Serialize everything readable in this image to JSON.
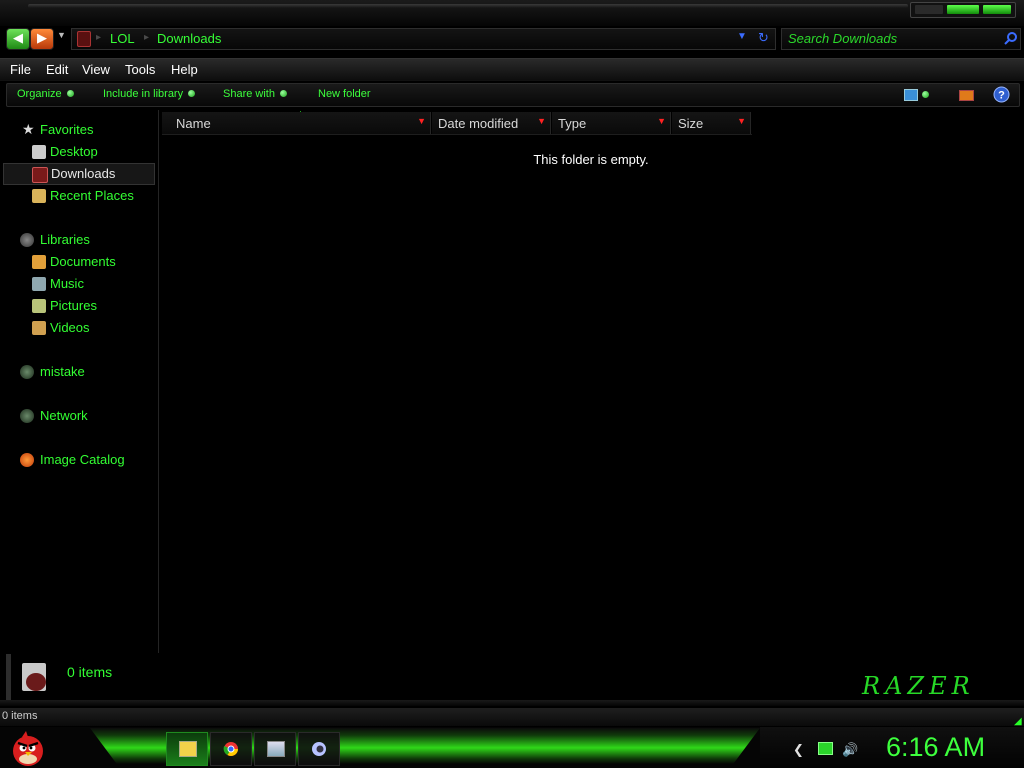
{
  "address": {
    "crumbs": [
      "LOL",
      "Downloads"
    ],
    "separator": "▸"
  },
  "search": {
    "placeholder": "Search Downloads"
  },
  "menu": [
    "File",
    "Edit",
    "View",
    "Tools",
    "Help"
  ],
  "commands": {
    "organize": "Organize",
    "include": "Include in library",
    "share": "Share with",
    "new_folder": "New folder"
  },
  "nav": {
    "favorites": "Favorites",
    "desktop": "Desktop",
    "downloads": "Downloads",
    "recent": "Recent Places",
    "libraries": "Libraries",
    "documents": "Documents",
    "music": "Music",
    "pictures": "Pictures",
    "videos": "Videos",
    "mistake": "mistake",
    "network": "Network",
    "image_catalog": "Image Catalog"
  },
  "columns": [
    "Name",
    "Date modified",
    "Type",
    "Size"
  ],
  "empty_message": "This folder is empty.",
  "details": {
    "items": "0 items",
    "brand": "RAZER"
  },
  "status": {
    "items": "0 items"
  },
  "clock": "6:16 AM",
  "colors": {
    "accent": "#33ff33",
    "background": "#000000",
    "sort_arrow": "#ff2222"
  },
  "icons": {
    "back": "back-arrow-icon",
    "forward": "forward-arrow-icon",
    "search": "magnifier-icon",
    "help": "help-icon",
    "start": "angry-bird-icon"
  }
}
